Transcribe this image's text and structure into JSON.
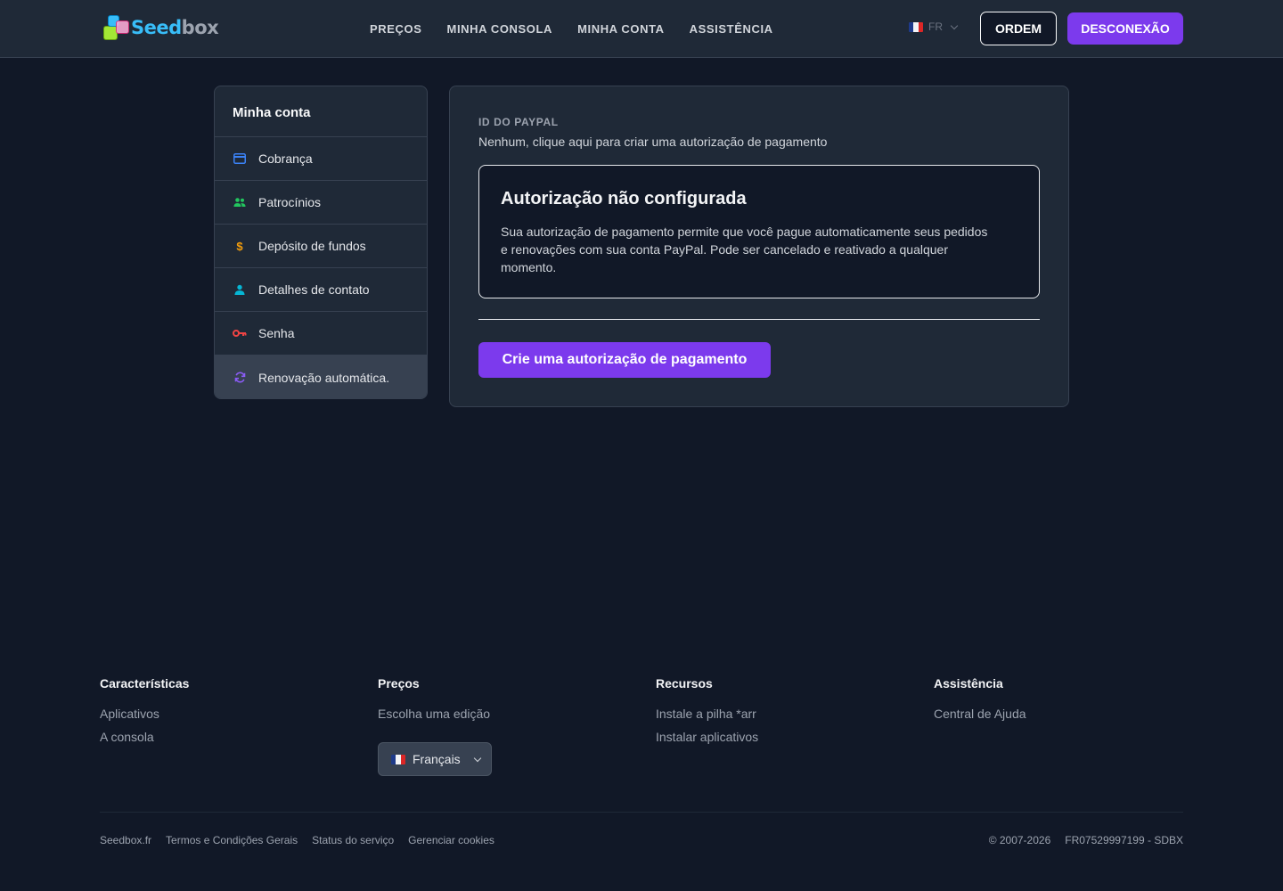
{
  "header": {
    "logo": {
      "part1": "Seed",
      "part2": "box"
    },
    "nav": [
      "PREÇOS",
      "MINHA CONSOLA",
      "MINHA CONTA",
      "ASSISTÊNCIA"
    ],
    "language": "FR",
    "order_label": "ORDEM",
    "logout_label": "DESCONEXÃO"
  },
  "sidebar": {
    "title": "Minha conta",
    "items": [
      {
        "label": "Cobrança",
        "icon": "credit-card-icon",
        "color": "#3b82f6"
      },
      {
        "label": "Patrocínios",
        "icon": "users-icon",
        "color": "#22c55e"
      },
      {
        "label": "Depósito de fundos",
        "icon": "dollar-icon",
        "color": "#f59e0b"
      },
      {
        "label": "Detalhes de contato",
        "icon": "user-icon",
        "color": "#06b6d4"
      },
      {
        "label": "Senha",
        "icon": "key-icon",
        "color": "#ef4444"
      },
      {
        "label": "Renovação automática.",
        "icon": "refresh-icon",
        "color": "#8b5cf6",
        "active": true
      }
    ]
  },
  "main": {
    "paypal_label": "ID DO PAYPAL",
    "paypal_value": "Nenhum, clique aqui para criar uma autorização de pagamento",
    "notice_title": "Autorização não configurada",
    "notice_text": "Sua autorização de pagamento permite que você pague automaticamente seus pedidos e renovações com sua conta PayPal. Pode ser cancelado e reativado a qualquer momento.",
    "create_button": "Crie uma autorização de pagamento"
  },
  "footer": {
    "columns": [
      {
        "title": "Características",
        "links": [
          "Aplicativos",
          "A consola"
        ]
      },
      {
        "title": "Preços",
        "links": [
          "Escolha uma edição"
        ]
      },
      {
        "title": "Recursos",
        "links": [
          "Instale a pilha *arr",
          "Instalar aplicativos"
        ]
      },
      {
        "title": "Assistência",
        "links": [
          "Central de Ajuda"
        ]
      }
    ],
    "language_select": "Français",
    "bottom_links": [
      "Seedbox.fr",
      "Termos e Condições Gerais",
      "Status do serviço",
      "Gerenciar cookies"
    ],
    "copyright": "© 2007-2026",
    "registration": "FR07529997199 - SDBX"
  },
  "colors": {
    "accent": "#7c3aed",
    "background": "#111827",
    "panel": "#1f2937"
  }
}
